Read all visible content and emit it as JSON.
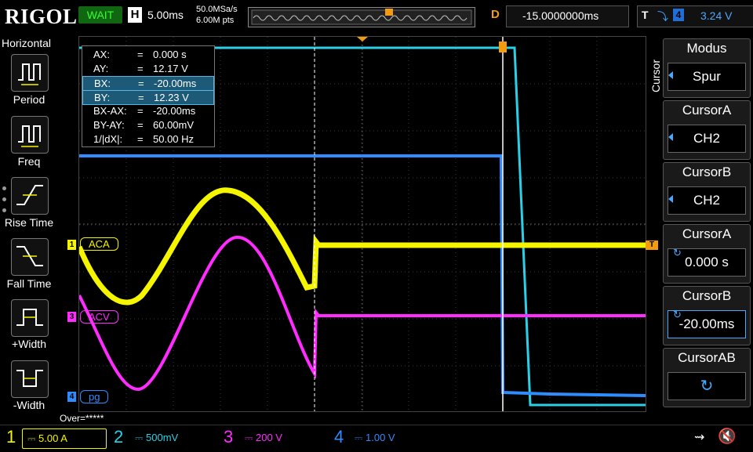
{
  "header": {
    "logo": "RIGOL",
    "status": "WAIT",
    "h_label": "H",
    "timebase": "5.00ms",
    "sample_rate": "50.0MSa/s",
    "memory_depth": "6.00M pts",
    "delay_label": "D",
    "delay_value": "-15.0000000ms",
    "trigger_label": "T",
    "trigger_source": "4",
    "trigger_level": "3.24 V"
  },
  "left_menu": {
    "title": "Horizontal",
    "items": [
      {
        "label": "Period",
        "icon": "period-icon"
      },
      {
        "label": "Freq",
        "icon": "freq-icon"
      },
      {
        "label": "Rise Time",
        "icon": "rise-time-icon"
      },
      {
        "label": "Fall Time",
        "icon": "fall-time-icon"
      },
      {
        "label": "+Width",
        "icon": "pos-width-icon"
      },
      {
        "label": "-Width",
        "icon": "neg-width-icon"
      }
    ]
  },
  "cursor_readout": {
    "rows": [
      {
        "key": "AX:",
        "value": "0.000 s",
        "highlight": false
      },
      {
        "key": "AY:",
        "value": "12.17 V",
        "highlight": false
      },
      {
        "key": "BX:",
        "value": "-20.00ms",
        "highlight": true
      },
      {
        "key": "BY:",
        "value": "12.23 V",
        "highlight": true
      },
      {
        "key": "BX-AX:",
        "value": "-20.00ms",
        "highlight": false
      },
      {
        "key": "BY-AY:",
        "value": "60.00mV",
        "highlight": false
      },
      {
        "key": "1/|dX|:",
        "value": "50.00 Hz",
        "highlight": false
      }
    ],
    "eq": "="
  },
  "channel_tags": {
    "ch1": {
      "num": "1",
      "label": "ACA",
      "color": "#f5f500"
    },
    "ch3": {
      "num": "3",
      "label": "ACV",
      "color": "#ff2bff"
    },
    "ch4": {
      "num": "4",
      "label": "pg",
      "color": "#2f8cff"
    }
  },
  "right_menu": {
    "title": "Cursor",
    "items": [
      {
        "head": "Modus",
        "value": "Spur",
        "type": "select"
      },
      {
        "head": "CursorA",
        "value": "CH2",
        "type": "select"
      },
      {
        "head": "CursorB",
        "value": "CH2",
        "type": "select"
      },
      {
        "head": "CursorA",
        "value": "0.000 s",
        "type": "knob"
      },
      {
        "head": "CursorB",
        "value": "-20.00ms",
        "type": "knob"
      },
      {
        "head": "CursorAB",
        "value": "",
        "type": "knob"
      }
    ]
  },
  "footer": {
    "overload": "Over=*****",
    "channels": [
      {
        "num": "1",
        "scale": "5.00 A",
        "color": "#f5f500"
      },
      {
        "num": "2",
        "scale": "500mV",
        "color": "#2ad0e8"
      },
      {
        "num": "3",
        "scale": "200 V",
        "color": "#ff2bff"
      },
      {
        "num": "4",
        "scale": "1.00 V",
        "color": "#2f8cff"
      }
    ]
  },
  "colors": {
    "ch1": "#f5f500",
    "ch2": "#2ad0e8",
    "ch3": "#ff2bff",
    "ch4": "#2f8cff",
    "accent": "#f39c12"
  }
}
